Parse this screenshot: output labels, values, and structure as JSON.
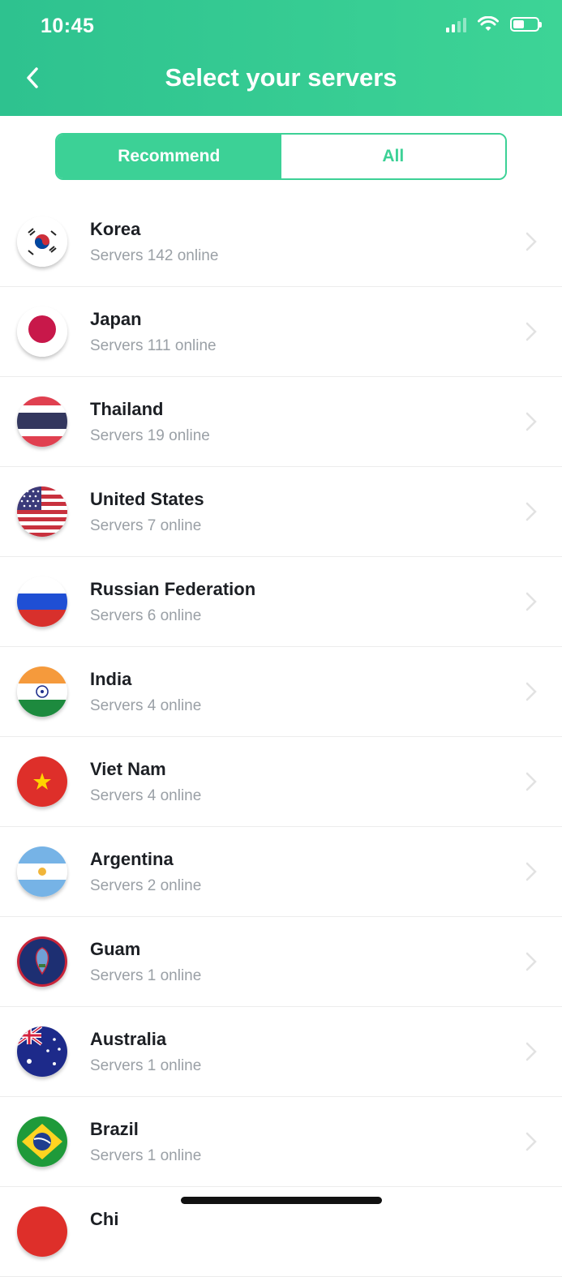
{
  "status_bar": {
    "time": "10:45",
    "battery_level": 0.45
  },
  "header": {
    "title": "Select your servers"
  },
  "tabs": {
    "recommend": "Recommend",
    "all": "All"
  },
  "servers": [
    {
      "country": "Korea",
      "count": "Servers 142 online",
      "flag": "korea-flag"
    },
    {
      "country": "Japan",
      "count": "Servers 111 online",
      "flag": "japan-flag"
    },
    {
      "country": "Thailand",
      "count": "Servers 19 online",
      "flag": "thailand-flag"
    },
    {
      "country": "United States",
      "count": "Servers 7 online",
      "flag": "usa-flag"
    },
    {
      "country": "Russian Federation",
      "count": "Servers 6 online",
      "flag": "russia-flag"
    },
    {
      "country": "India",
      "count": "Servers 4 online",
      "flag": "india-flag"
    },
    {
      "country": "Viet Nam",
      "count": "Servers 4 online",
      "flag": "vietnam-flag"
    },
    {
      "country": "Argentina",
      "count": "Servers 2 online",
      "flag": "argentina-flag"
    },
    {
      "country": "Guam",
      "count": "Servers 1 online",
      "flag": "guam-flag"
    },
    {
      "country": "Australia",
      "count": "Servers 1 online",
      "flag": "australia-flag"
    },
    {
      "country": "Brazil",
      "count": "Servers 1 online",
      "flag": "brazil-flag"
    },
    {
      "country": "Chi",
      "count": "",
      "flag": "china-flag"
    }
  ],
  "colors": {
    "accent": "#3cd196",
    "header": "#2ec28f",
    "text": "#1c1f24",
    "muted": "#9aa0a6"
  }
}
